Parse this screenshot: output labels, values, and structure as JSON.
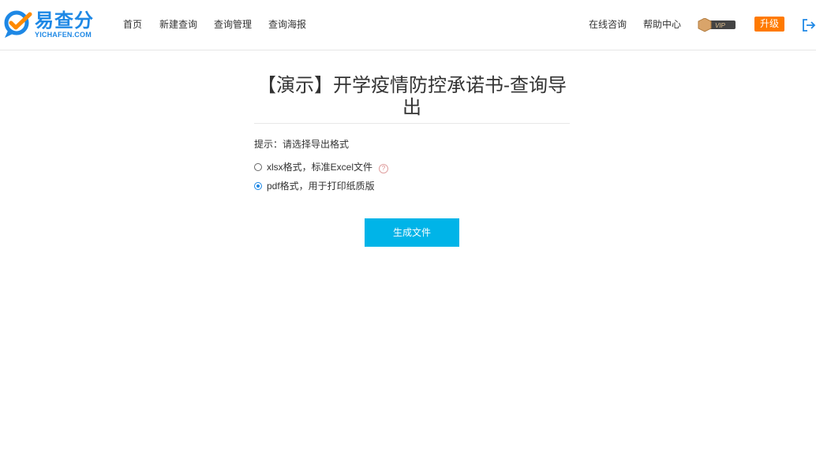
{
  "header": {
    "logo_text": "易查分",
    "logo_sub": "YICHAFEN.COM",
    "nav": [
      "首页",
      "新建查询",
      "查询管理",
      "查询海报"
    ],
    "right_nav": [
      "在线咨询",
      "帮助中心"
    ],
    "vip_label": "VIP",
    "upgrade_label": "升级"
  },
  "main": {
    "title": "【演示】开学疫情防控承诺书-查询导出",
    "hint": "提示：请选择导出格式",
    "options": [
      {
        "label": "xlsx格式，标准Excel文件",
        "checked": false
      },
      {
        "label": "pdf格式，用于打印纸质版",
        "checked": true
      }
    ],
    "help_glyph": "?",
    "generate_label": "生成文件"
  },
  "colors": {
    "brand": "#1e88e5",
    "upgrade": "#ff7a00",
    "button": "#00b4e8"
  }
}
